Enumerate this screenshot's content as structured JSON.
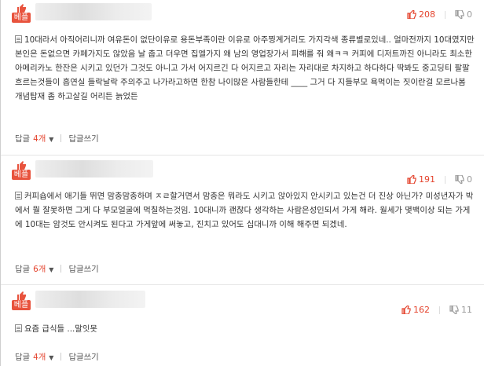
{
  "best_label": "베플",
  "reply_label": "답글",
  "reply_write_label": "답글쓰기",
  "comments": [
    {
      "upvotes": "208",
      "downvotes": "0",
      "text": "10대라서 아직어리니까 여유돈이 없단이유로 용돈부족이란 이유로 아주찡계거리도 가지각색 종류별로있네.. 얼마전까지 10대였지만 본인은 돈없으면 카페가지도 않았음 날 춥고 더우면 집엘가지 왜 남의 영업장가서 피해를 줘 왜ㅋㅋ 커피에 디저트까진 아니라도 최소한 아메리카노 한잔은 시키고 있던가 그것도 아니고 가서 어지르긴 다 어지르고 자리는 자리대로 차지하고 하다하다 딱봐도 중고딩티 팔팔 흐르는것들이 흡연실 들락날락 주의주고 나가라고하면 한참 나이많은 사람들한테 ____ 그거 다 지들부모 욕먹이는 짓이란걸 모르나봄 개념탑재 좀 하고살길 어리든 늙었든",
      "reply_count": "4개"
    },
    {
      "upvotes": "191",
      "downvotes": "0",
      "text": "커피숍에서 애기들 뛰면 맘충맘충하며 ㅈㄹ할거면서 맘충은 뭐라도 시키고 앉아있지 안시키고 있는건 더 진상 아닌가? 미성년자가 박에서 뭘 잘못하면 그게 다 부모얼굴에 먹칠하는것임. 10대니까 괜찮다 생각하는 사람은성인되서 가게 해라. 월세가 몇백이상 되는 가게에 10대는 암것도 안시켜도 된다고 가게앞에 써놓고, 진치고 있어도 십대니까 이해 해주면 되겠네.",
      "reply_count": "6개"
    },
    {
      "upvotes": "162",
      "downvotes": "11",
      "text": "요즘 급식들 ...말잇못",
      "reply_count": "4개"
    }
  ],
  "colors": {
    "accent": "#e4432d",
    "best_tag": "#e8533d"
  },
  "icons": {
    "upvote": "thumbs-up-icon",
    "downvote": "thumbs-down-icon",
    "best": "thumbs-up-badge-icon",
    "comment": "document-icon",
    "caret": "caret-down-icon"
  }
}
